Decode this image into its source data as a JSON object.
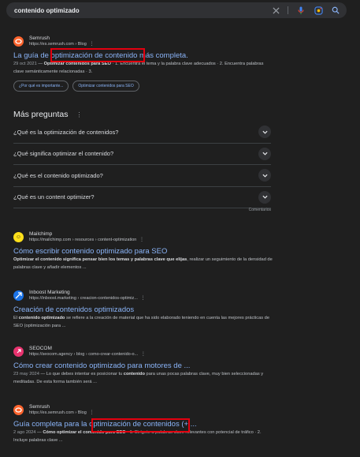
{
  "search": {
    "query": "contenido optimizado"
  },
  "results": [
    {
      "site": "Semrush",
      "url": "https://es.semrush.com › Blog",
      "title_pre": "La guía de ",
      "title_hl": "optimización de contenido",
      "title_post": " más completa.",
      "date": "29 oct 2021",
      "snippet_b": "Optimizar contenidos para SEO",
      "snippet_rest": " · 1. Encuentra el tema y la palabra clave adecuados · 2. Encuentra palabras clave semánticamente relacionadas · 3.",
      "chips": [
        "¿Por qué es importante...",
        "Optimizar contenidos para SEO"
      ]
    },
    {
      "site": "Mailchimp",
      "url": "https://mailchimp.com › resources › content-optimization",
      "title": "Cómo escribir contenido optimizado para SEO",
      "snippet_b": "Optimizar el contenido significa pensar bien los temas y palabras clave que elijas",
      "snippet_rest": ", realizar un seguimiento de la densidad de palabras clave y añadir elementos ..."
    },
    {
      "site": "Inboost Marketing",
      "url": "https://inboost.marketing › creacion-contenidos-optimiz...",
      "title": "Creación de contenidos optimizados",
      "snippet_a": "El ",
      "snippet_b": "contenido optimizado",
      "snippet_rest": " se refiere a la creación de material que ha sido elaborado teniendo en cuenta las mejores prácticas de SEO (optimización para ..."
    },
    {
      "site": "SEOCOM",
      "url": "https://seocom.agency › blog › como-crear-contenido-o...",
      "title": "Cómo crear contenido optimizado para motores de ...",
      "date": "23 may 2024",
      "snippet_a": "Lo que debes intentar es posicionar tu ",
      "snippet_b": "contenido",
      "snippet_rest": " para unas pocas palabras clave, muy bien seleccionadas y meditadas. De esta forma también será ..."
    },
    {
      "site": "Semrush",
      "url": "https://es.semrush.com › Blog",
      "title_pre": "Guía completa para la ",
      "title_hl": "optimización de contenidos",
      "title_post": " (+ ...",
      "date": "2 ago 2024",
      "snippet_b": "Cómo optimizar el contenido para SEO",
      "snippet_rest": " · 1. Dirígete a palabras clave relevantes con potencial de tráfico · 2. Incluye palabras clave ..."
    }
  ],
  "paa": {
    "title": "Más preguntas",
    "questions": [
      "¿Qué es la optimización de contenidos?",
      "¿Qué significa optimizar el contenido?",
      "¿Qué es el contenido optimizado?",
      "¿Qué es un content optimizer?"
    ],
    "feedback": "Comentarios"
  },
  "colors": {
    "background": "#1f1f1f",
    "link": "#8ab4f8",
    "highlight_box": "#e3000f",
    "semrush": "#ff642d",
    "mailchimp": "#ffe01b",
    "inboost": "#1a73e8",
    "seocom": "#e8336f"
  },
  "icons": [
    "clear-icon",
    "mic-icon",
    "lens-icon",
    "search-icon",
    "chevron-down-icon",
    "more-vert-icon"
  ]
}
